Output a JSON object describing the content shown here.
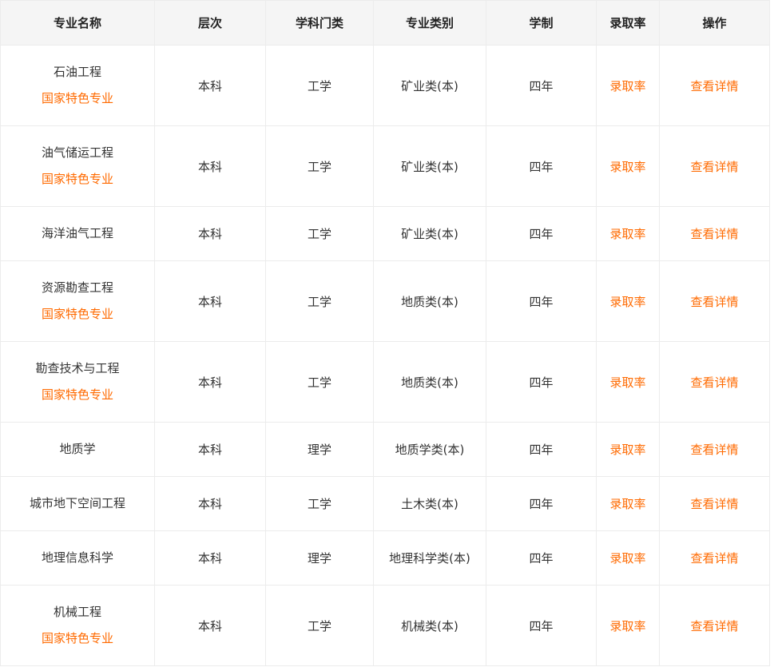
{
  "colors": {
    "accent": "#ff6a00",
    "header_bg": "#f5f5f5",
    "border": "#ececec",
    "text": "#333333"
  },
  "table": {
    "headers": {
      "name": "专业名称",
      "level": "层次",
      "discipline": "学科门类",
      "category": "专业类别",
      "duration": "学制",
      "admission": "录取率",
      "action": "操作"
    },
    "rows": [
      {
        "name": "石油工程",
        "badge": "国家特色专业",
        "level": "本科",
        "discipline": "工学",
        "category": "矿业类(本)",
        "duration": "四年",
        "admission_link": "录取率",
        "detail_link": "查看详情"
      },
      {
        "name": "油气储运工程",
        "badge": "国家特色专业",
        "level": "本科",
        "discipline": "工学",
        "category": "矿业类(本)",
        "duration": "四年",
        "admission_link": "录取率",
        "detail_link": "查看详情"
      },
      {
        "name": "海洋油气工程",
        "badge": "",
        "level": "本科",
        "discipline": "工学",
        "category": "矿业类(本)",
        "duration": "四年",
        "admission_link": "录取率",
        "detail_link": "查看详情"
      },
      {
        "name": "资源勘查工程",
        "badge": "国家特色专业",
        "level": "本科",
        "discipline": "工学",
        "category": "地质类(本)",
        "duration": "四年",
        "admission_link": "录取率",
        "detail_link": "查看详情"
      },
      {
        "name": "勘查技术与工程",
        "badge": "国家特色专业",
        "level": "本科",
        "discipline": "工学",
        "category": "地质类(本)",
        "duration": "四年",
        "admission_link": "录取率",
        "detail_link": "查看详情"
      },
      {
        "name": "地质学",
        "badge": "",
        "level": "本科",
        "discipline": "理学",
        "category": "地质学类(本)",
        "duration": "四年",
        "admission_link": "录取率",
        "detail_link": "查看详情"
      },
      {
        "name": "城市地下空间工程",
        "badge": "",
        "level": "本科",
        "discipline": "工学",
        "category": "土木类(本)",
        "duration": "四年",
        "admission_link": "录取率",
        "detail_link": "查看详情"
      },
      {
        "name": "地理信息科学",
        "badge": "",
        "level": "本科",
        "discipline": "理学",
        "category": "地理科学类(本)",
        "duration": "四年",
        "admission_link": "录取率",
        "detail_link": "查看详情"
      },
      {
        "name": "机械工程",
        "badge": "国家特色专业",
        "level": "本科",
        "discipline": "工学",
        "category": "机械类(本)",
        "duration": "四年",
        "admission_link": "录取率",
        "detail_link": "查看详情"
      }
    ]
  }
}
